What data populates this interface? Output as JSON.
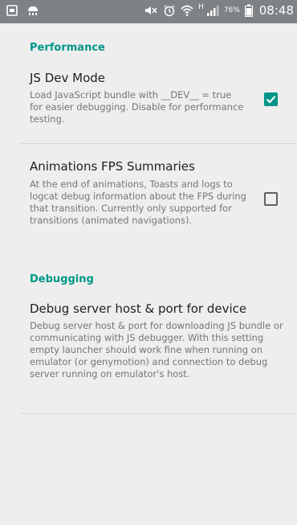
{
  "status_bar": {
    "battery_percent": "76%",
    "network_type": "H",
    "time": "08:48",
    "icons": [
      "screenshot-icon",
      "notification-icon",
      "mute-icon",
      "alarm-icon",
      "wifi-icon",
      "signal-icon",
      "battery-icon"
    ]
  },
  "sections": {
    "performance": {
      "title": "Performance"
    },
    "debugging": {
      "title": "Debugging"
    }
  },
  "preferences": {
    "js_dev_mode": {
      "title": "JS Dev Mode",
      "summary": "Load JavaScript bundle with __DEV__ = true for easier debugging.  Disable for performance testing.",
      "checked": true
    },
    "animations_fps": {
      "title": "Animations FPS Summaries",
      "summary": "At the end of animations, Toasts and logs to logcat debug information about the FPS during that transition. Currently only supported for transitions (animated navigations).",
      "checked": false
    },
    "debug_server": {
      "title": "Debug server host & port for device",
      "summary": "Debug server host & port for downloading JS bundle or communicating with JS debugger. With this setting empty launcher should work fine when running on emulator (or genymotion) and connection to debug server running on emulator's host."
    }
  },
  "colors": {
    "accent": "#009688",
    "status_bar": "#7e8285",
    "background": "#eeeeee"
  }
}
